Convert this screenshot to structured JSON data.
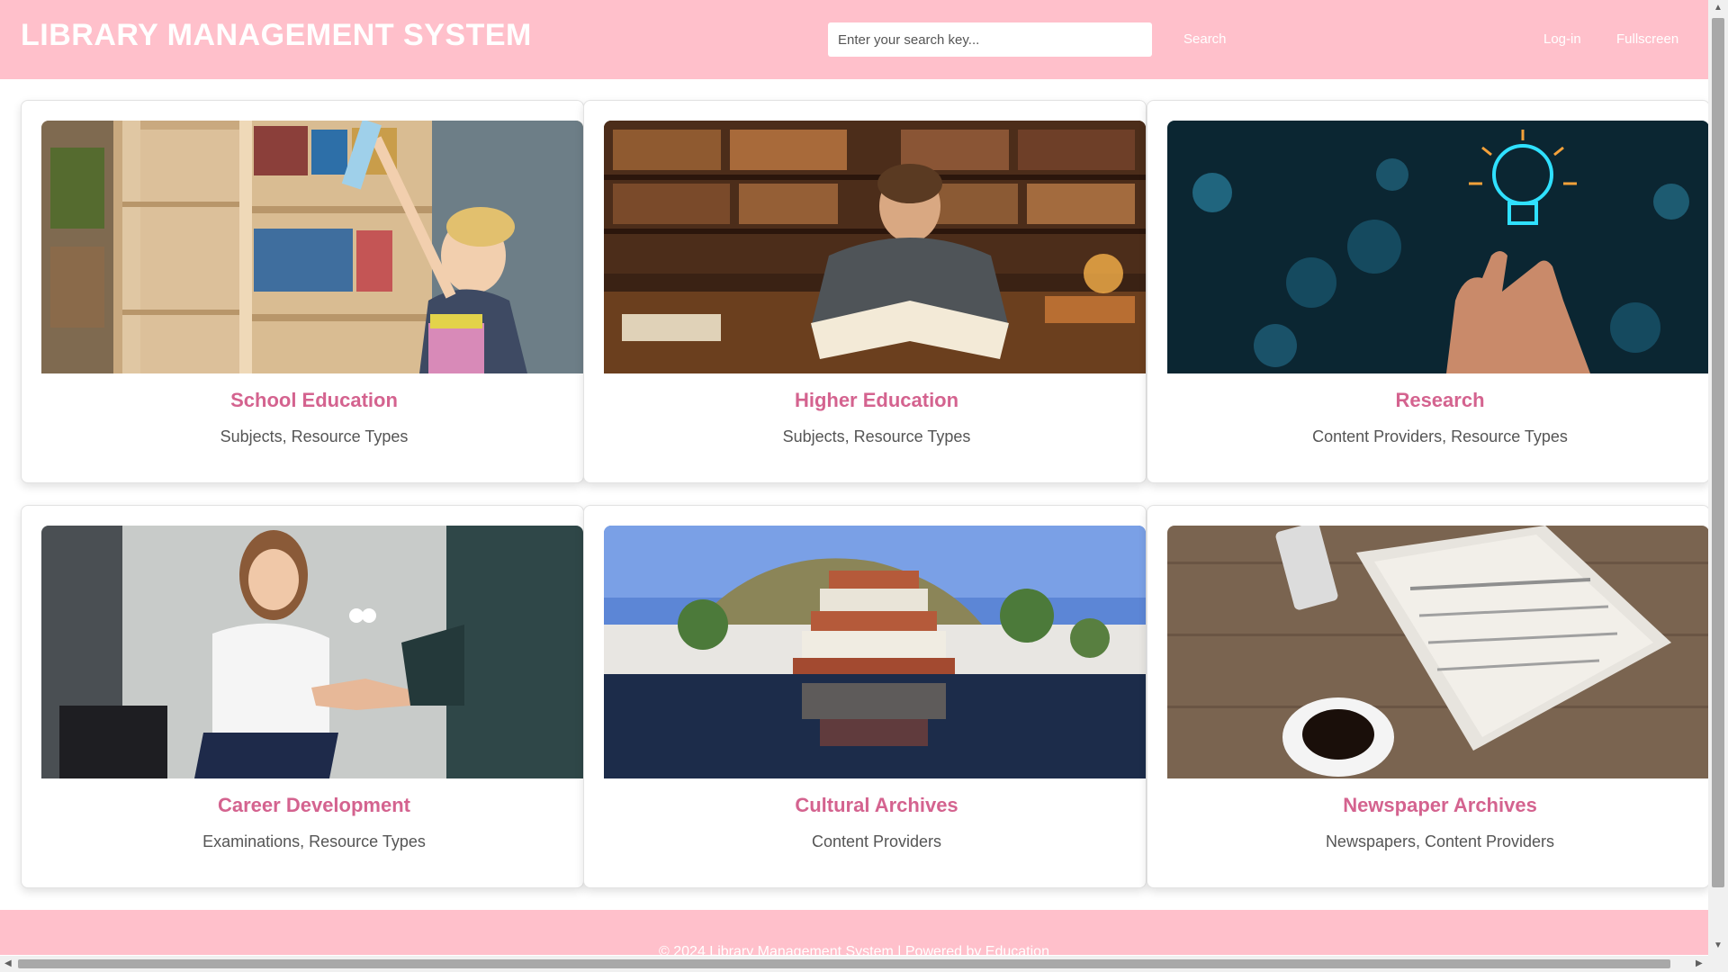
{
  "header": {
    "title": "LIBRARY MANAGEMENT SYSTEM",
    "search_placeholder": "Enter your search key...",
    "search_label": "Search",
    "login_label": "Log-in",
    "fullscreen_label": "Fullscreen"
  },
  "cards": [
    {
      "title": "School Education",
      "subtitle": "Subjects, Resource Types",
      "image": "child-at-bookshelf-photo"
    },
    {
      "title": "Higher Education",
      "subtitle": "Subjects, Resource Types",
      "image": "student-reading-in-library-photo"
    },
    {
      "title": "Research",
      "subtitle": "Content Providers, Resource Types",
      "image": "hand-with-glowing-lightbulb-photo"
    },
    {
      "title": "Career Development",
      "subtitle": "Examinations, Resource Types",
      "image": "business-handshake-photo"
    },
    {
      "title": "Cultural Archives",
      "subtitle": "Content Providers",
      "image": "pagoda-building-reflection-photo"
    },
    {
      "title": "Newspaper Archives",
      "subtitle": "Newspapers, Content Providers",
      "image": "newspaper-and-coffee-photo"
    }
  ],
  "footer": {
    "text": "© 2024 Library Management System | Powered by Education"
  },
  "colors": {
    "brand": "#ffc0cb",
    "card_title": "#d4638f"
  }
}
